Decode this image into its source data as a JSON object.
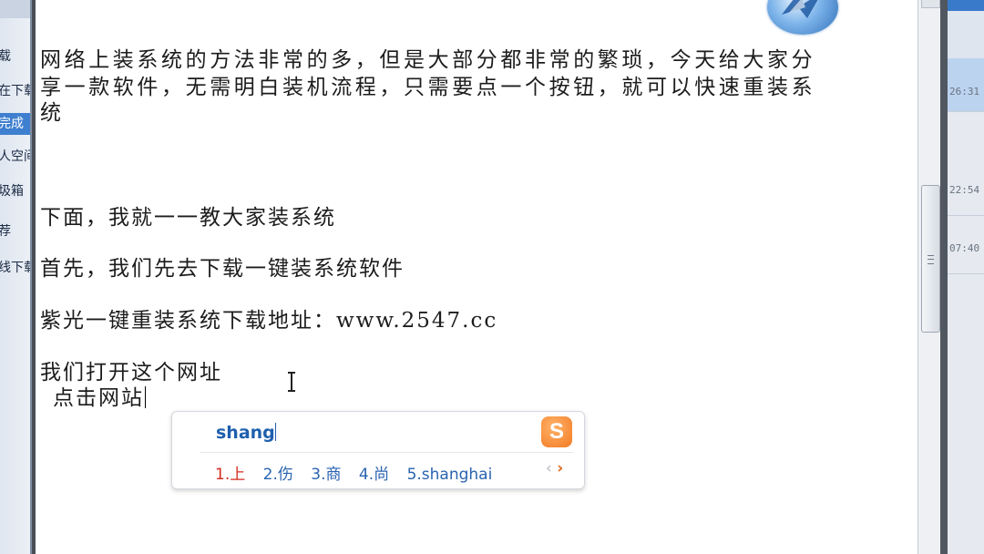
{
  "sidebar": {
    "items": [
      {
        "label": "载"
      },
      {
        "label": "在下载"
      },
      {
        "label": "完成"
      },
      {
        "label": "人空间"
      },
      {
        "label": "圾箱"
      },
      {
        "label": "荐"
      },
      {
        "label": "线下载"
      }
    ]
  },
  "document": {
    "paragraph_line1": "网络上装系统的方法非常的多，但是大部分都非常的繁琐，今天给大家分",
    "paragraph_line2": "享一款软件，无需明白装机流程，只需要点一个按钮，就可以快速重装系",
    "paragraph_line3": "统",
    "line_next": "下面，我就一一教大家装系统",
    "line_first": "首先，我们先去下载一键装系统软件",
    "line_download": "紫光一键重装系统下载地址：www.2547.cc",
    "line_open": "我们打开这个网址",
    "line_click": "点击网站"
  },
  "ime": {
    "input": "shang",
    "logo": "S",
    "candidates": [
      "1.上",
      "2.伤",
      "3.商",
      "4.尚",
      "5.shanghai"
    ],
    "prev": "‹",
    "next": "›"
  },
  "right_panel": {
    "times": [
      "26:31",
      "22:54",
      "07:40"
    ]
  },
  "colors": {
    "ime_text": "#2a63b0",
    "ime_active": "#d52a1d",
    "selected_item": "#3f7fcf"
  }
}
